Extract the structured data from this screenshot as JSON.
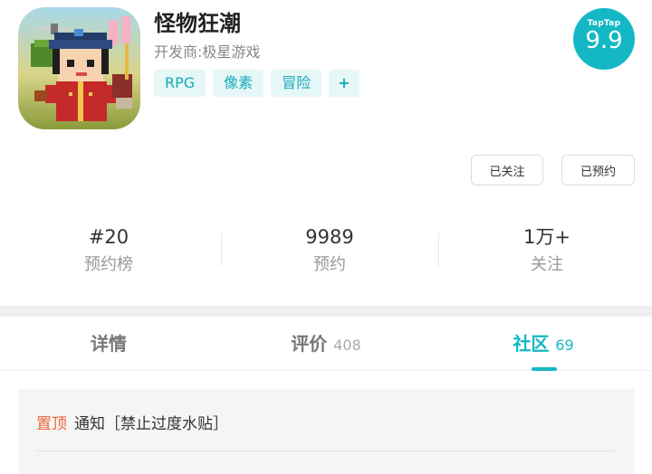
{
  "game": {
    "title": "怪物狂潮",
    "developer": "开发商:极星游戏",
    "tags": [
      "RPG",
      "像素",
      "冒险"
    ],
    "more_tags": "+"
  },
  "rating": {
    "brand": "TapTap",
    "score": "9.9"
  },
  "actions": {
    "followed": "已关注",
    "reserved": "已预约"
  },
  "stats": [
    {
      "value": "#20",
      "label": "预约榜"
    },
    {
      "value": "9989",
      "label": "预约"
    },
    {
      "value": "1万+",
      "label": "关注"
    }
  ],
  "tabs": [
    {
      "label": "详情",
      "count": ""
    },
    {
      "label": "评价",
      "count": "408"
    },
    {
      "label": "社区",
      "count": "69"
    }
  ],
  "notice": {
    "pin": "置顶",
    "text": "通知［禁止过度水贴］"
  },
  "colors": {
    "accent": "#14b8c4",
    "pin": "#e8663b"
  }
}
